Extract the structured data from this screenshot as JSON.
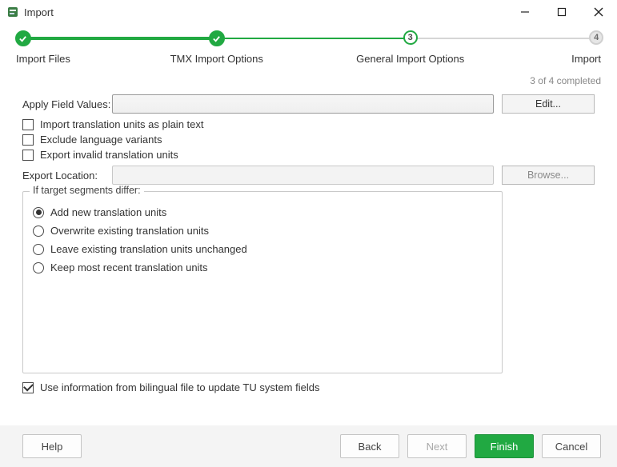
{
  "window": {
    "title": "Import"
  },
  "stepper": {
    "steps": [
      {
        "label": "Import Files",
        "state": "done"
      },
      {
        "label": "TMX Import Options",
        "state": "done"
      },
      {
        "label": "General Import Options",
        "state": "active",
        "num": "3"
      },
      {
        "label": "Import",
        "state": "pending",
        "num": "4"
      }
    ],
    "progress_text": "3 of 4 completed"
  },
  "fields": {
    "apply_label": "Apply Field Values:",
    "apply_value": "",
    "edit_btn": "Edit...",
    "export_label": "Export Location:",
    "export_value": "",
    "browse_btn": "Browse..."
  },
  "checkboxes": {
    "plain_text": {
      "label": "Import translation units as plain text",
      "checked": false
    },
    "exclude_variants": {
      "label": "Exclude language variants",
      "checked": false
    },
    "export_invalid": {
      "label": "Export invalid translation units",
      "checked": false
    },
    "use_bilingual": {
      "label": "Use information from bilingual file to update TU system fields",
      "checked": true
    }
  },
  "group": {
    "title": "If target segments differ:",
    "options": [
      "Add new translation units",
      "Overwrite existing translation units",
      "Leave existing translation units unchanged",
      "Keep most recent translation units"
    ],
    "selected": 0
  },
  "footer": {
    "help": "Help",
    "back": "Back",
    "next": "Next",
    "finish": "Finish",
    "cancel": "Cancel"
  }
}
